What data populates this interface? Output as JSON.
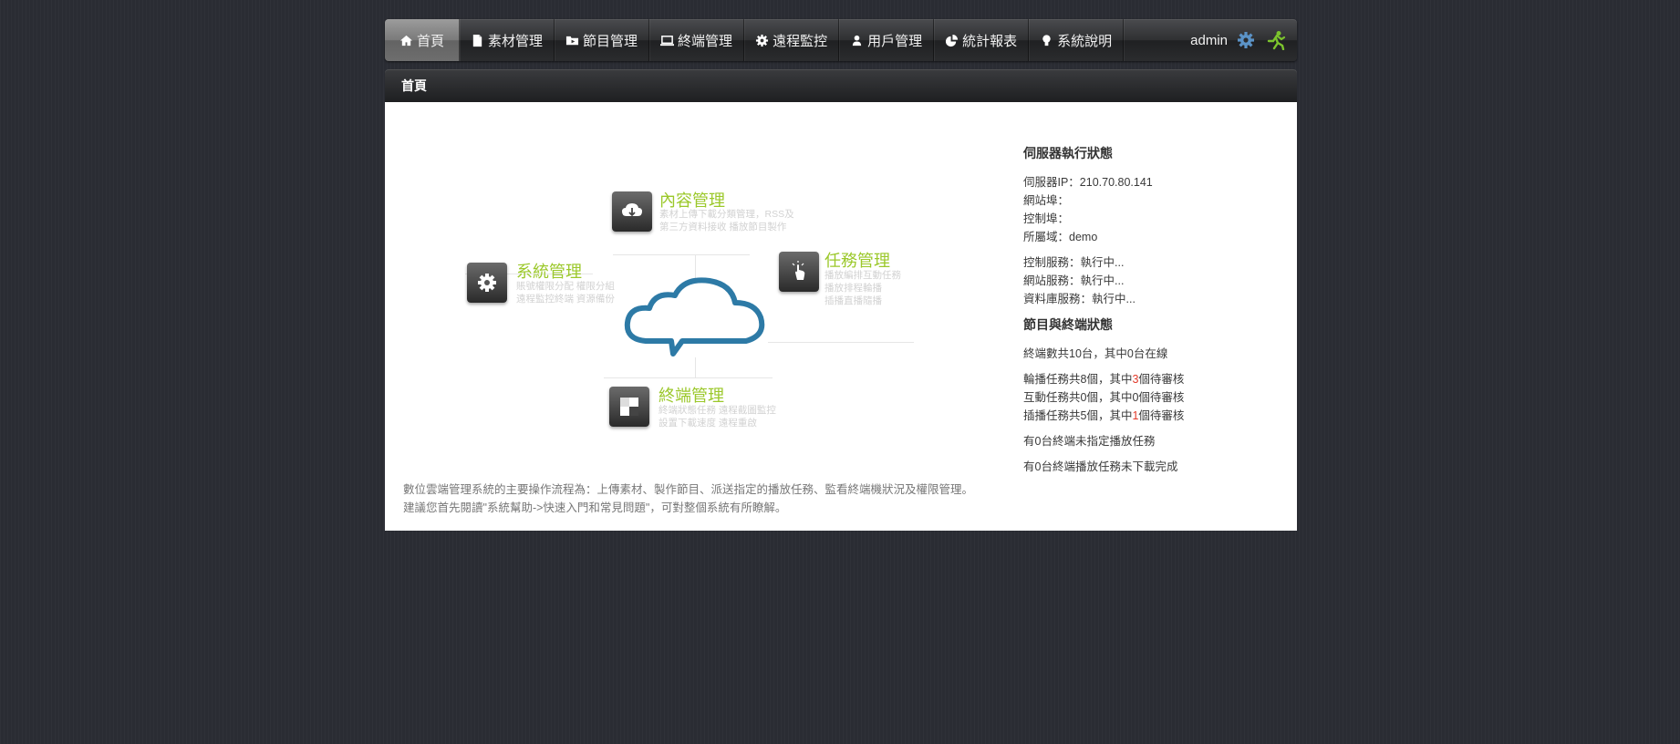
{
  "nav": {
    "items": [
      {
        "label": "首頁",
        "icon": "home-icon",
        "active": true
      },
      {
        "label": "素材管理",
        "icon": "document-icon"
      },
      {
        "label": "節目管理",
        "icon": "folder-icon"
      },
      {
        "label": "終端管理",
        "icon": "monitor-icon"
      },
      {
        "label": "遠程監控",
        "icon": "gear-small-icon"
      },
      {
        "label": "用戶管理",
        "icon": "user-icon"
      },
      {
        "label": "統計報表",
        "icon": "pie-chart-icon"
      },
      {
        "label": "系統說明",
        "icon": "lightbulb-icon"
      }
    ],
    "user": "admin",
    "settings_icon": "settings-gear-icon",
    "logout_icon": "running-man-icon",
    "accent": "#7cc42d"
  },
  "breadcrumb": {
    "current": "首頁"
  },
  "diagram": {
    "content": {
      "title": "內容管理",
      "desc": [
        "素材上傳下載分類管理，RSS及",
        "第三方資料接收 播放節目製作"
      ]
    },
    "task": {
      "title": "任務管理",
      "desc": [
        "播放編排互動任務",
        "播放排程輪播",
        "插播直播隨播"
      ]
    },
    "system": {
      "title": "系統管理",
      "desc": [
        "賬號權限分配 權限分組",
        "遠程監控終端 資源備份"
      ]
    },
    "terminal": {
      "title": "終端管理",
      "desc": [
        "終端狀態任務 遠程截圖監控",
        "設置下載速度 遠程重啟"
      ]
    },
    "title_color": "#9bc82a"
  },
  "help": {
    "line1": "數位雲端管理系統的主要操作流程為：上傳素材、製作節目、派送指定的播放任務、監看終端機狀況及權限管理。",
    "line2": "建議您首先閱讀\"系統幫助->快速入門和常見問題\"，可對整個系統有所瞭解。"
  },
  "server_status": {
    "title": "伺服器執行狀態",
    "ip": "伺服器IP：210.70.80.141",
    "web_port": "網站埠：",
    "control_port": "控制埠：",
    "domain": "所屬域：demo",
    "control_service": "控制服務：執行中...",
    "web_service": "網站服務：執行中...",
    "db_service": "資料庫服務：執行中..."
  },
  "program_status": {
    "title": "節目與終端狀態",
    "terminals": "終端數共10台，其中0台在線",
    "rotation": {
      "pre": "輪播任務共8個，其中",
      "count": "3",
      "post": "個待審核"
    },
    "interactive": {
      "pre": "互動任務共0個，其中",
      "count": "0",
      "post": "個待審核"
    },
    "insert": {
      "pre": "插播任務共5個，其中",
      "count": "1",
      "post": "個待審核"
    },
    "unassigned": "有0台終端未指定播放任務",
    "not_downloaded": "有0台終端播放任務未下載完成"
  }
}
